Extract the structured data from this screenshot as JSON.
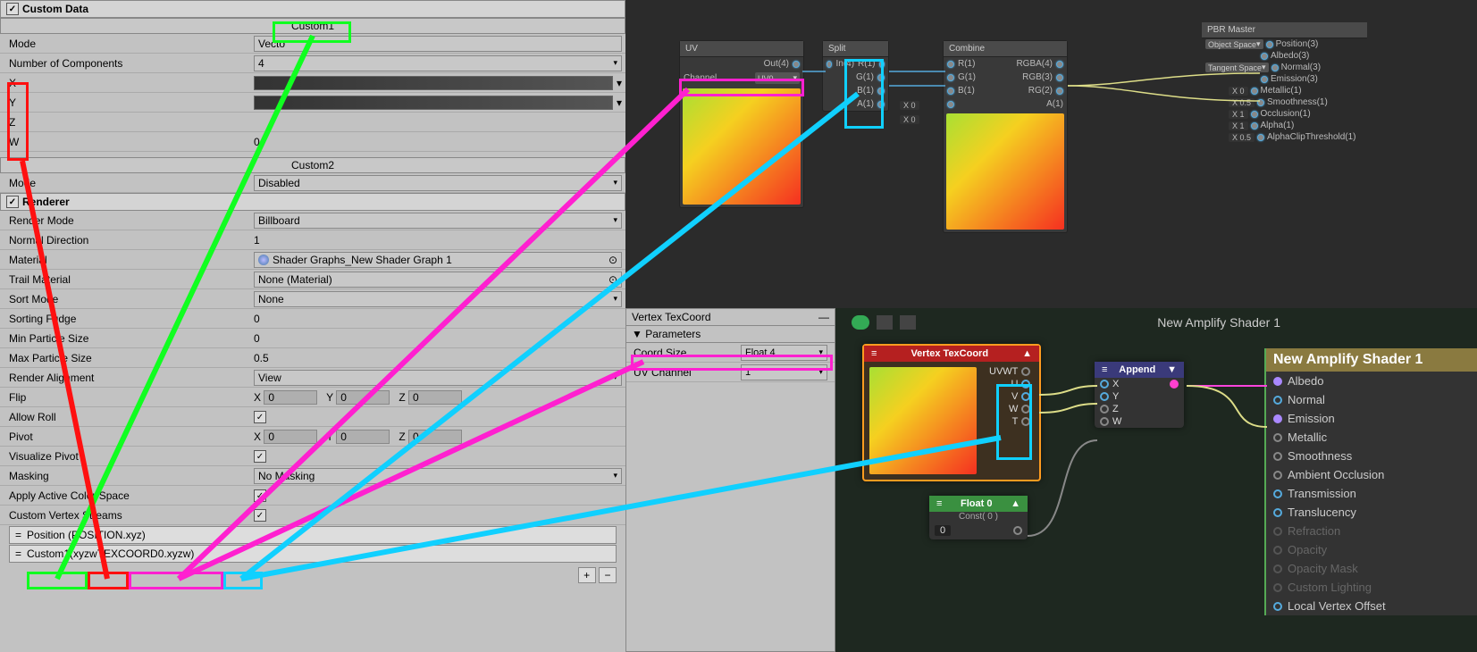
{
  "inspector": {
    "custom_data_title": "Custom Data",
    "custom1_header": "Custom1",
    "mode_label": "Mode",
    "mode_value1": "Vecto",
    "numcomp_label": "Number of Components",
    "numcomp_value": "4",
    "x_label": "X",
    "y_label": "Y",
    "z_label": "Z",
    "w_label": "W",
    "slider_val_x": "",
    "slider_val_z": "",
    "slider_val_w": "0",
    "custom2_header": "Custom2",
    "mode2_value": "Disabled",
    "renderer_title": "Renderer",
    "rows": {
      "render_mode": {
        "label": "Render Mode",
        "value": "Billboard"
      },
      "normal_dir": {
        "label": "Normal Direction",
        "value": "1"
      },
      "material": {
        "label": "Material",
        "value": "Shader Graphs_New Shader Graph 1"
      },
      "trail_mat": {
        "label": "Trail Material",
        "value": "None (Material)"
      },
      "sort_mode": {
        "label": "Sort Mode",
        "value": "None"
      },
      "sort_fudge": {
        "label": "Sorting Fudge",
        "value": "0"
      },
      "min_ps": {
        "label": "Min Particle Size",
        "value": "0"
      },
      "max_ps": {
        "label": "Max Particle Size",
        "value": "0.5"
      },
      "render_align": {
        "label": "Render Alignment",
        "value": "View"
      },
      "flip": {
        "label": "Flip",
        "x": "X",
        "xv": "0",
        "y": "Y",
        "yv": "0",
        "z": "Z",
        "zv": "0"
      },
      "allow_roll": {
        "label": "Allow Roll"
      },
      "pivot": {
        "label": "Pivot",
        "x": "X",
        "xv": "0",
        "y": "Y",
        "yv": "0",
        "z": "Z",
        "zv": "0"
      },
      "viz_pivot": {
        "label": "Visualize Pivot"
      },
      "masking": {
        "label": "Masking",
        "value": "No Masking"
      },
      "color_space": {
        "label": "Apply Active Color Space"
      },
      "streams_label": "Custom Vertex Streams",
      "stream1": "Position (POSITION.xyz)",
      "stream2_a": "Custom1",
      "stream2_b": "xyzw",
      "stream2_c": "TEXCOORD0",
      "stream2_d": "xyzw"
    }
  },
  "shadergraph": {
    "uv_node": {
      "title": "UV",
      "out": "Out(4)",
      "channel_label": "Channel",
      "channel_val": "UV0"
    },
    "split_node": {
      "title": "Split",
      "in": "In(4)",
      "r": "R(1)",
      "g": "G(1)",
      "b": "B(1)",
      "a": "A(1)"
    },
    "combine_node": {
      "title": "Combine",
      "r": "R(1)",
      "g": "G(1)",
      "b": "B(1)",
      "a": "A(1)",
      "rgba": "RGBA(4)",
      "rgb": "RGB(3)",
      "rg": "RG(2)"
    },
    "x0_a": "X  0",
    "x0_b": "X  0",
    "pbr": {
      "title": "PBR Master",
      "obj_space": "Object Space",
      "tan_space": "Tangent Space",
      "position": "Position(3)",
      "albedo": "Albedo(3)",
      "normal": "Normal(3)",
      "emission": "Emission(3)",
      "metallic": "Metallic(1)",
      "metallic_v": "X  0",
      "smooth": "Smoothness(1)",
      "smooth_v": "X  0.5",
      "occlusion": "Occlusion(1)",
      "occ_v": "X  1",
      "alpha": "Alpha(1)",
      "alpha_v": "X  1",
      "clip": "AlphaClipThreshold(1)",
      "clip_v": "X  0.5"
    }
  },
  "vtc_panel": {
    "title": "Vertex TexCoord",
    "params": "Parameters",
    "coord_size_label": "Coord Size",
    "coord_size_val": "Float 4",
    "uv_channel_label": "UV Channel",
    "uv_channel_val": "1"
  },
  "amplify": {
    "title": "New Amplify Shader 1",
    "vtc_node": {
      "title": "Vertex TexCoord",
      "uvwt": "UVWT",
      "u": "U",
      "v": "V",
      "w": "W",
      "t": "T"
    },
    "append_node": {
      "title": "Append",
      "x": "X",
      "y": "Y",
      "z": "Z",
      "w": "W"
    },
    "float_node": {
      "title": "Float 0",
      "sub": "Const( 0 )",
      "val": "0"
    },
    "output": {
      "title": "New Amplify Shader 1",
      "albedo": "Albedo",
      "normal": "Normal",
      "emission": "Emission",
      "metallic": "Metallic",
      "smoothness": "Smoothness",
      "ao": "Ambient Occlusion",
      "trans": "Transmission",
      "translucency": "Translucency",
      "refraction": "Refraction",
      "opacity": "Opacity",
      "opmask": "Opacity Mask",
      "custom": "Custom Lighting",
      "lvo": "Local Vertex Offset"
    }
  }
}
